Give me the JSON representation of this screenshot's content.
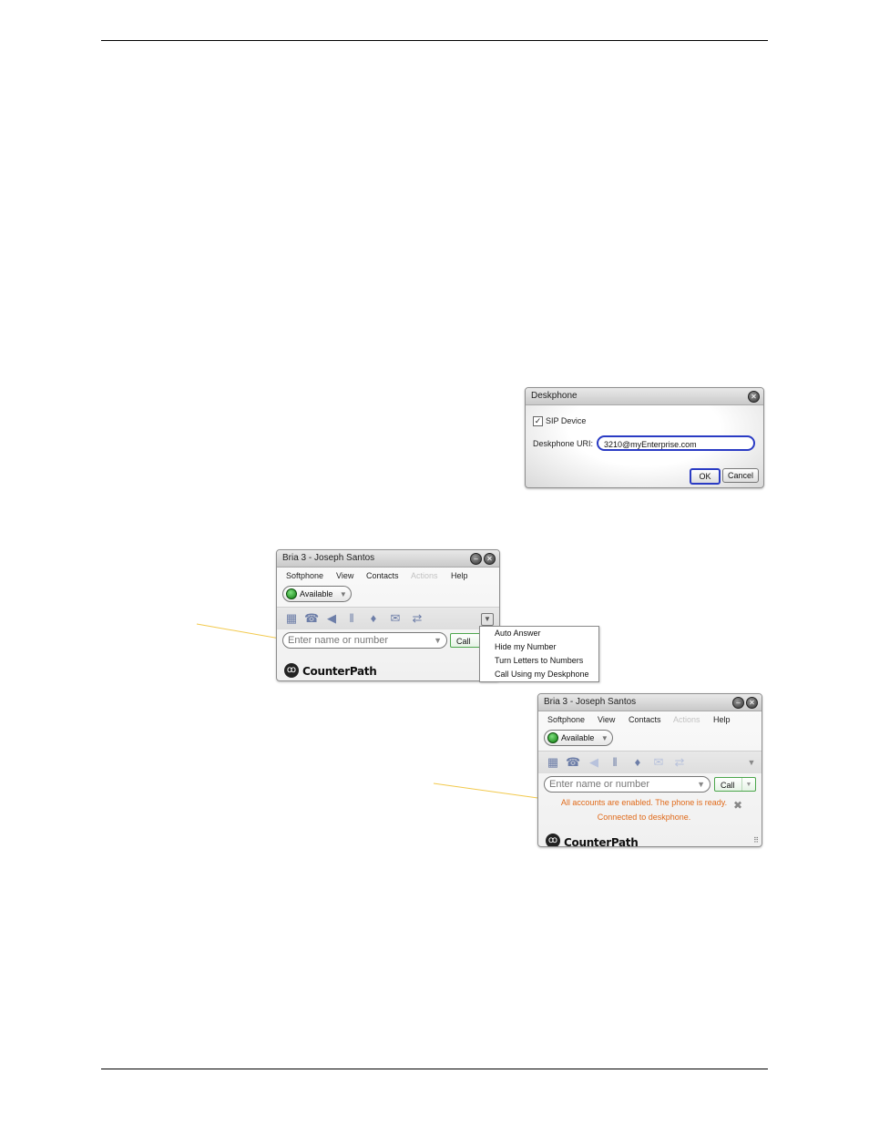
{
  "deskphone_dialog": {
    "title": "Deskphone",
    "close_icon": "close-icon",
    "sip_device_label": "SIP Device",
    "sip_device_checked": true,
    "uri_label": "Deskphone URI:",
    "uri_value": "3210@myEnterprise.com",
    "ok_label": "OK",
    "cancel_label": "Cancel"
  },
  "bria_window_1": {
    "title": "Bria 3 - Joseph Santos",
    "menu": [
      "Softphone",
      "View",
      "Contacts",
      "Actions",
      "Help"
    ],
    "presence": "Available",
    "search_placeholder": "Enter name or number",
    "call_label": "Call",
    "brand": "CounterPath"
  },
  "dropdown_menu": {
    "items": [
      "Auto Answer",
      "Hide my Number",
      "Turn Letters to Numbers",
      "Call Using my Deskphone"
    ]
  },
  "bria_window_2": {
    "title": "Bria 3 - Joseph Santos",
    "menu": [
      "Softphone",
      "View",
      "Contacts",
      "Actions",
      "Help"
    ],
    "presence": "Available",
    "search_placeholder": "Enter name or number",
    "call_label": "Call",
    "status_line_1": "All accounts are enabled. The phone is ready.",
    "status_line_2": "Connected to deskphone.",
    "brand": "CounterPath"
  },
  "colors": {
    "status_text": "#e06a1a",
    "callout_line": "#f2c94c",
    "focus_border": "#2a3bc4"
  }
}
